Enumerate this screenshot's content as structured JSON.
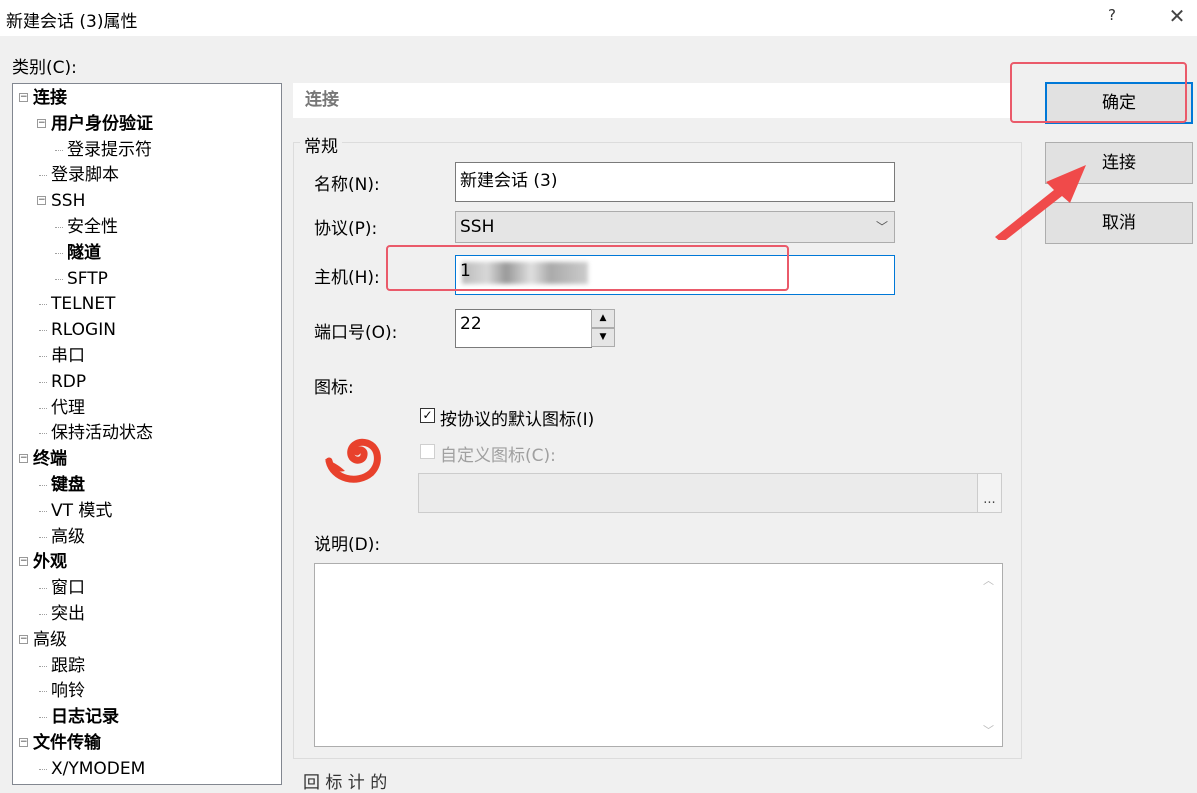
{
  "window": {
    "title": "新建会话 (3)属性",
    "help_glyph": "?",
    "close_glyph": "✕"
  },
  "category_label": "类别(C):",
  "tree": [
    {
      "label": "连接",
      "level": 0,
      "bold": true,
      "expander": "⊟"
    },
    {
      "label": "用户身份验证",
      "level": 1,
      "bold": true,
      "expander": "⊟"
    },
    {
      "label": "登录提示符",
      "level": 2,
      "bold": false
    },
    {
      "label": "登录脚本",
      "level": 1,
      "bold": false
    },
    {
      "label": "SSH",
      "level": 1,
      "bold": false,
      "expander": "⊟"
    },
    {
      "label": "安全性",
      "level": 2,
      "bold": false
    },
    {
      "label": "隧道",
      "level": 2,
      "bold": true
    },
    {
      "label": "SFTP",
      "level": 2,
      "bold": false
    },
    {
      "label": "TELNET",
      "level": 1,
      "bold": false
    },
    {
      "label": "RLOGIN",
      "level": 1,
      "bold": false
    },
    {
      "label": "串口",
      "level": 1,
      "bold": false
    },
    {
      "label": "RDP",
      "level": 1,
      "bold": false
    },
    {
      "label": "代理",
      "level": 1,
      "bold": false
    },
    {
      "label": "保持活动状态",
      "level": 1,
      "bold": false
    },
    {
      "label": "终端",
      "level": 0,
      "bold": true,
      "expander": "⊟"
    },
    {
      "label": "键盘",
      "level": 1,
      "bold": true
    },
    {
      "label": "VT 模式",
      "level": 1,
      "bold": false
    },
    {
      "label": "高级",
      "level": 1,
      "bold": false
    },
    {
      "label": "外观",
      "level": 0,
      "bold": true,
      "expander": "⊟"
    },
    {
      "label": "窗口",
      "level": 1,
      "bold": false
    },
    {
      "label": "突出",
      "level": 1,
      "bold": false
    },
    {
      "label": "高级",
      "level": 0,
      "bold": false,
      "expander": "⊟"
    },
    {
      "label": "跟踪",
      "level": 1,
      "bold": false
    },
    {
      "label": "响铃",
      "level": 1,
      "bold": false
    },
    {
      "label": "日志记录",
      "level": 1,
      "bold": true
    },
    {
      "label": "文件传输",
      "level": 0,
      "bold": true,
      "expander": "⊟"
    },
    {
      "label": "X/YMODEM",
      "level": 1,
      "bold": false
    }
  ],
  "section_header": "连接",
  "group_general": "常规",
  "fields": {
    "name_label": "名称(N):",
    "name_value": "新建会话 (3)",
    "protocol_label": "协议(P):",
    "protocol_value": "SSH",
    "host_label": "主机(H):",
    "host_value_leading": "1",
    "host_value_trailing": "",
    "port_label": "端口号(O):",
    "port_value": "22"
  },
  "icon_section": {
    "label": "图标:",
    "default_icon_checkbox": "按协议的默认图标(I)",
    "default_icon_checked": true,
    "custom_icon_checkbox": "自定义图标(C):",
    "custom_icon_checked": false,
    "browse_label": "..."
  },
  "description_label": "说明(D):",
  "buttons": {
    "ok": "确定",
    "connect": "连接",
    "cancel": "取消"
  },
  "bottom_clipped_text": "回 标 计 的",
  "colors": {
    "accent": "#0078d7",
    "annotation": "#ea5a6a",
    "arrow": "#f04a4a",
    "app_icon": "#e8412c"
  }
}
